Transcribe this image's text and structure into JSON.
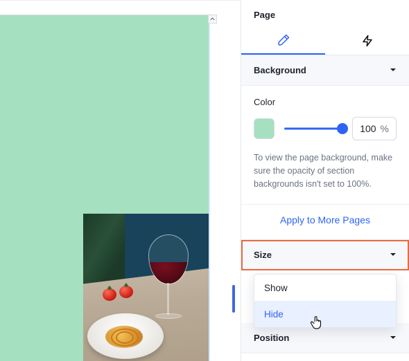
{
  "panel": {
    "title": "Page",
    "tabs": {
      "design": "design",
      "interactions": "interactions"
    }
  },
  "background": {
    "header": "Background",
    "color_label": "Color",
    "swatch_hex": "#a5e0c0",
    "opacity_value": "100",
    "opacity_unit": "%",
    "hint": "To view the page background, make sure the opacity of section backgrounds isn't set to 100%.",
    "apply_link": "Apply to More Pages"
  },
  "size": {
    "header": "Size",
    "options": {
      "show": "Show",
      "hide": "Hide"
    },
    "selected": "hide"
  },
  "position": {
    "header": "Position"
  },
  "canvas": {
    "bg_hex": "#a5e0c0"
  }
}
